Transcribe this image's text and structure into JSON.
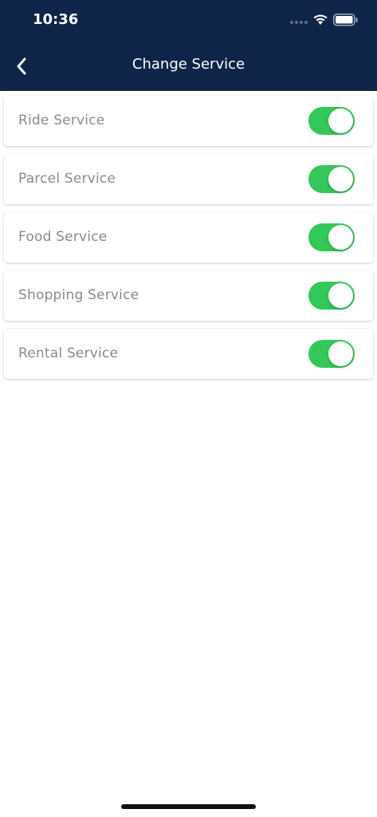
{
  "status_bar": {
    "time": "10:36"
  },
  "header": {
    "title": "Change Service",
    "back_icon": "chevron-left-icon",
    "background_color": "#0e2549"
  },
  "services": [
    {
      "label": "Ride Service",
      "enabled": true
    },
    {
      "label": "Parcel Service",
      "enabled": true
    },
    {
      "label": "Food Service",
      "enabled": true
    },
    {
      "label": "Shopping Service",
      "enabled": true
    },
    {
      "label": "Rental Service",
      "enabled": true
    }
  ],
  "colors": {
    "toggle_on": "#34c759",
    "label_text": "#8a8a8a"
  }
}
